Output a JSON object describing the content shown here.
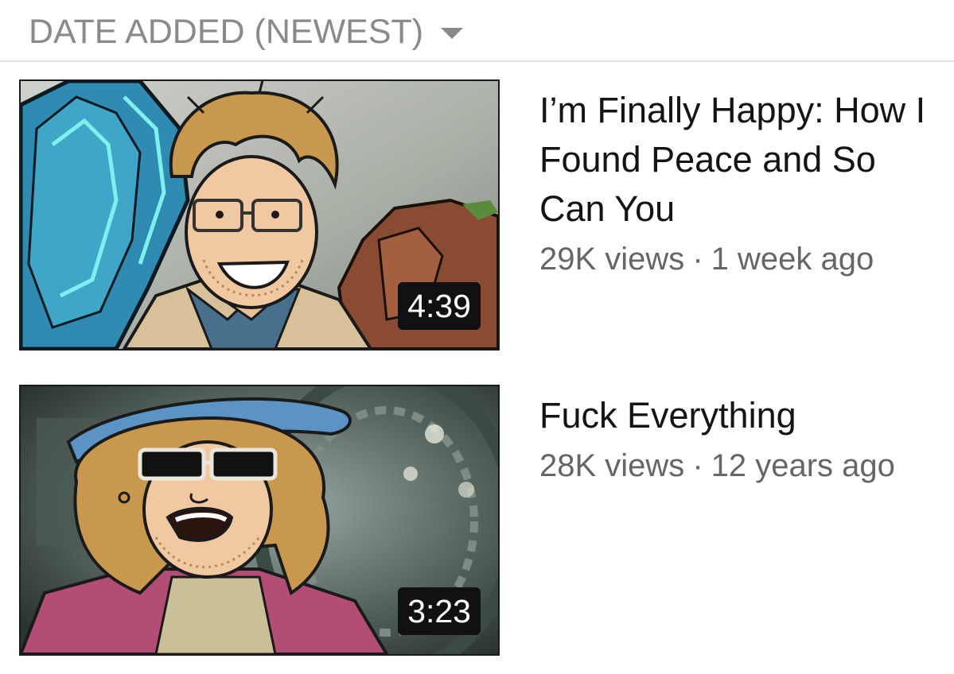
{
  "sort": {
    "label": "DATE ADDED (NEWEST)",
    "icon": "caret-down-icon"
  },
  "colors": {
    "muted_text": "#8a8a8a",
    "title_text": "#141414",
    "stats_text": "#666666",
    "duration_bg": "#111111"
  },
  "videos": [
    {
      "title": "I’m Finally Happy: How I Found Peace and So Can You",
      "views": "29K views",
      "separator": "·",
      "age": "1 week ago",
      "duration": "4:39"
    },
    {
      "title": "Fuck Everything",
      "views": "28K views",
      "separator": "·",
      "age": "12 years ago",
      "duration": "3:23"
    }
  ]
}
